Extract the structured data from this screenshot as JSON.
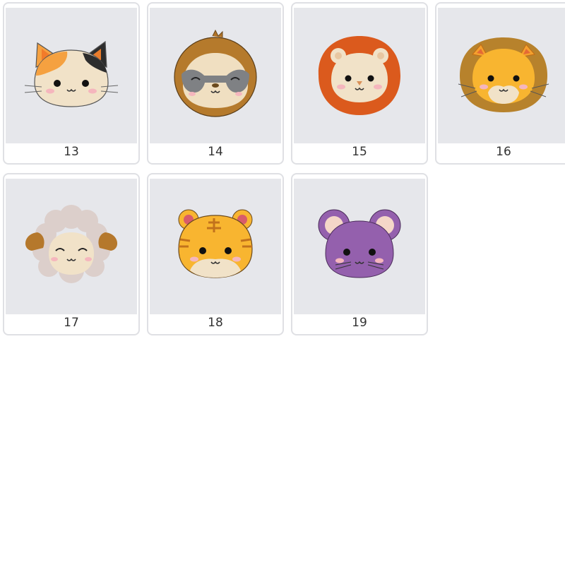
{
  "gallery": {
    "items": [
      {
        "number": "13",
        "icon": "calico-cat-face-icon"
      },
      {
        "number": "14",
        "icon": "sloth-face-icon"
      },
      {
        "number": "15",
        "icon": "lion-face-red-mane-icon"
      },
      {
        "number": "16",
        "icon": "lion-face-brown-mane-icon"
      },
      {
        "number": "17",
        "icon": "sheep-face-icon"
      },
      {
        "number": "18",
        "icon": "tiger-face-icon"
      },
      {
        "number": "19",
        "icon": "purple-mouse-face-icon"
      }
    ]
  },
  "colors": {
    "card_border": "#dfe0e4",
    "thumb_bg": "#e6e7eb",
    "label_text": "#333333"
  }
}
